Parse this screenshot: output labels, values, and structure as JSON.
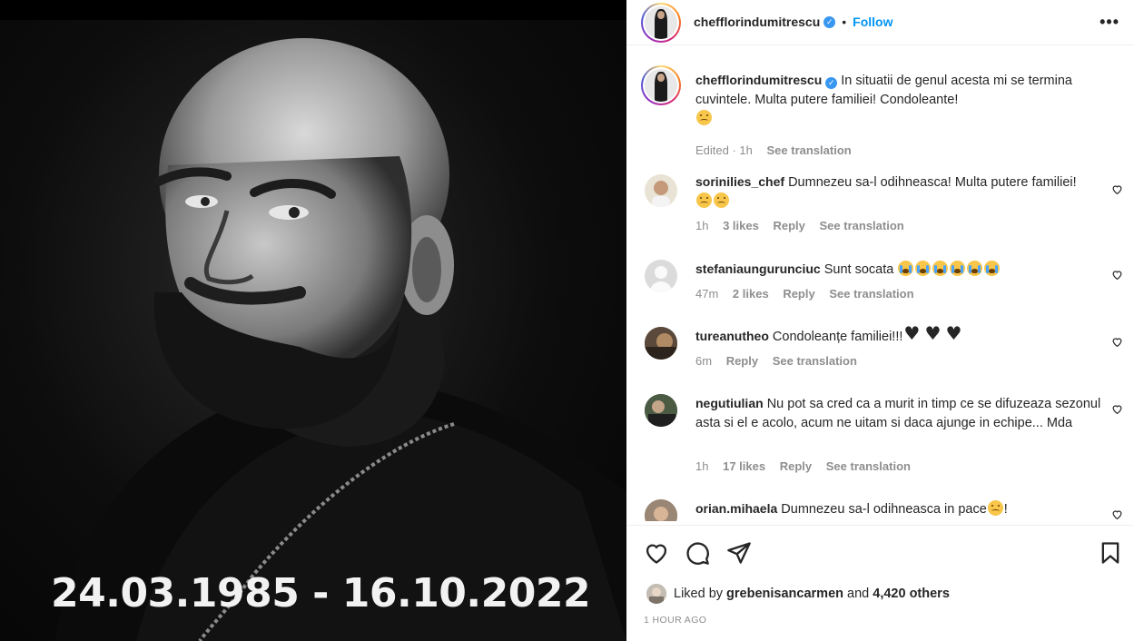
{
  "media": {
    "dates_text": "24.03.1985 - 16.10.2022"
  },
  "header": {
    "username": "chefflorindumitrescu",
    "separator": "•",
    "follow_label": "Follow",
    "more_icon": "more-horizontal-icon"
  },
  "caption": {
    "username": "chefflorindumitrescu",
    "text": "In situatii de genul acesta mi se termina cuvintele. Multa putere familiei! Condoleante!",
    "edited": "Edited · 1h",
    "see_translation": "See translation"
  },
  "comments": [
    {
      "username": "sorinilies_chef",
      "text": "Dumnezeu sa-l odihneasca! Multa putere familiei!",
      "time": "1h",
      "likes": "3 likes",
      "reply": "Reply",
      "see_translation": "See translation"
    },
    {
      "username": "stefaniaungurunciuc",
      "text": "Sunt socata",
      "time": "47m",
      "likes": "2 likes",
      "reply": "Reply",
      "see_translation": "See translation"
    },
    {
      "username": "tureanutheo",
      "text": "Condoleanțe familiei!!!",
      "time": "6m",
      "reply": "Reply",
      "see_translation": "See translation"
    },
    {
      "username": "negutiulian",
      "text": "Nu pot sa cred ca a murit in timp ce se difuzeaza sezonul asta si el e acolo, acum ne uitam si daca ajunge in echipe... Mda",
      "time": "1h",
      "likes": "17 likes",
      "reply": "Reply",
      "see_translation": "See translation"
    },
    {
      "username": "orian.mihaela",
      "text": "Dumnezeu sa-l odihneasca in pace",
      "trailing": "!"
    }
  ],
  "actions": {
    "liked_prefix": "Liked by",
    "liked_user": "grebenisancarmen",
    "liked_and": "and",
    "liked_others": "4,420 others",
    "timestamp": "1 HOUR AGO"
  },
  "colors": {
    "accent": "#0095f6",
    "verified": "#3897f0",
    "muted": "#8e8e8e"
  }
}
